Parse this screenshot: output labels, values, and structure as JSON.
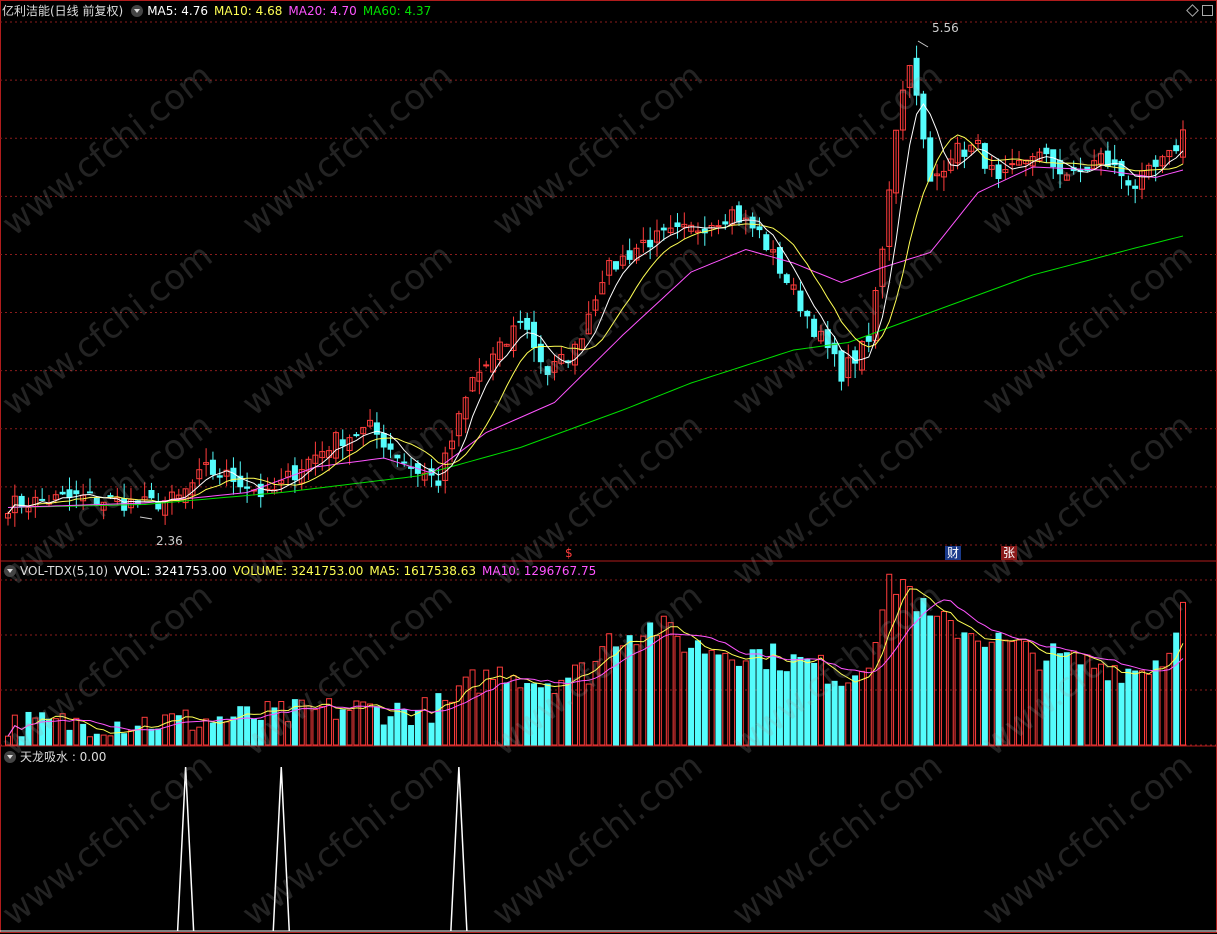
{
  "colors": {
    "up": "#ff3c3c",
    "down": "#54fcfc",
    "ma5": "#ffffff",
    "ma10": "#ffff54",
    "ma20": "#ff54ff",
    "ma60": "#00e000",
    "grid": "#8a1c1c",
    "border": "#b01c1c"
  },
  "price_panel": {
    "stock_name": "亿利洁能(日线 前复权)",
    "indicators": [
      {
        "label": "MA5: 4.76",
        "color": "#ffffff"
      },
      {
        "label": "MA10: 4.68",
        "color": "#ffff54"
      },
      {
        "label": "MA20: 4.70",
        "color": "#ff54ff"
      },
      {
        "label": "MA60: 4.37",
        "color": "#00e000"
      }
    ],
    "high_label": "5.56",
    "low_label": "2.36",
    "event_markers": [
      {
        "text": "$",
        "color": "#ff3c3c"
      },
      {
        "text": "财",
        "color": "#ffffff",
        "bg": "#1a3a8a"
      },
      {
        "text": "张",
        "color": "#ffffff",
        "bg": "#8a1a1a"
      }
    ]
  },
  "volume_panel": {
    "title": "VOL-TDX(5,10)",
    "indicators": [
      {
        "label": "VVOL: 3241753.00",
        "color": "#ffffff"
      },
      {
        "label": "VOLUME: 3241753.00",
        "color": "#ffff54"
      },
      {
        "label": "MA5: 1617538.63",
        "color": "#ffff54"
      },
      {
        "label": "MA10: 1296767.75",
        "color": "#ff54ff"
      }
    ]
  },
  "signal_panel": {
    "title": "天龙吸水 : 0.00"
  },
  "watermark_text": "www.cfchi.com",
  "chart_data": [
    {
      "type": "candlestick",
      "ylim": [
        2.2,
        5.7
      ],
      "high": 5.56,
      "low": 2.36,
      "close_anchors": [
        [
          0,
          2.47
        ],
        [
          10,
          2.52
        ],
        [
          20,
          2.47
        ],
        [
          25,
          2.51
        ],
        [
          29,
          2.7
        ],
        [
          34,
          2.63
        ],
        [
          38,
          2.52
        ],
        [
          43,
          2.73
        ],
        [
          48,
          2.9
        ],
        [
          53,
          2.98
        ],
        [
          59,
          2.72
        ],
        [
          63,
          2.63
        ],
        [
          68,
          3.3
        ],
        [
          73,
          3.55
        ],
        [
          75,
          3.72
        ],
        [
          79,
          3.35
        ],
        [
          83,
          3.5
        ],
        [
          87,
          4.0
        ],
        [
          93,
          4.22
        ],
        [
          100,
          4.3
        ],
        [
          106,
          4.42
        ],
        [
          110,
          4.28
        ],
        [
          118,
          3.65
        ],
        [
          122,
          3.35
        ],
        [
          126,
          3.55
        ],
        [
          128,
          4.2
        ],
        [
          130,
          5.0
        ],
        [
          132,
          5.45
        ],
        [
          135,
          4.6
        ],
        [
          138,
          4.82
        ],
        [
          142,
          4.85
        ],
        [
          145,
          4.6
        ],
        [
          150,
          4.82
        ],
        [
          156,
          4.65
        ],
        [
          160,
          4.78
        ],
        [
          165,
          4.6
        ],
        [
          170,
          4.78
        ],
        [
          172,
          4.95
        ]
      ],
      "ma60_anchors": [
        [
          0,
          2.45
        ],
        [
          20,
          2.47
        ],
        [
          40,
          2.55
        ],
        [
          60,
          2.66
        ],
        [
          75,
          2.85
        ],
        [
          90,
          3.1
        ],
        [
          100,
          3.28
        ],
        [
          115,
          3.5
        ],
        [
          123,
          3.55
        ],
        [
          135,
          3.75
        ],
        [
          150,
          4.0
        ],
        [
          165,
          4.18
        ],
        [
          172,
          4.26
        ]
      ],
      "ma20_anchors": [
        [
          0,
          2.45
        ],
        [
          20,
          2.48
        ],
        [
          35,
          2.55
        ],
        [
          45,
          2.72
        ],
        [
          55,
          2.78
        ],
        [
          62,
          2.68
        ],
        [
          70,
          2.95
        ],
        [
          80,
          3.15
        ],
        [
          90,
          3.6
        ],
        [
          100,
          4.02
        ],
        [
          108,
          4.17
        ],
        [
          115,
          4.08
        ],
        [
          122,
          3.95
        ],
        [
          128,
          4.05
        ],
        [
          135,
          4.15
        ],
        [
          142,
          4.55
        ],
        [
          150,
          4.72
        ],
        [
          160,
          4.7
        ],
        [
          168,
          4.65
        ],
        [
          172,
          4.7
        ]
      ]
    },
    {
      "type": "bar",
      "ylim": [
        0,
        3300000
      ],
      "last_volume": 3241753,
      "ma5_last": 1617538.63,
      "ma10_last": 1296767.75,
      "volume_profile": [
        [
          0,
          0.12
        ],
        [
          30,
          0.15
        ],
        [
          50,
          0.22
        ],
        [
          60,
          0.2
        ],
        [
          65,
          0.25
        ],
        [
          68,
          0.38
        ],
        [
          73,
          0.45
        ],
        [
          78,
          0.38
        ],
        [
          85,
          0.45
        ],
        [
          88,
          0.65
        ],
        [
          95,
          0.72
        ],
        [
          100,
          0.6
        ],
        [
          110,
          0.55
        ],
        [
          118,
          0.48
        ],
        [
          123,
          0.4
        ],
        [
          126,
          0.55
        ],
        [
          129,
          0.95
        ],
        [
          131,
          1.0
        ],
        [
          135,
          0.75
        ],
        [
          140,
          0.7
        ],
        [
          150,
          0.55
        ],
        [
          165,
          0.45
        ],
        [
          170,
          0.55
        ],
        [
          172,
          0.95
        ]
      ]
    },
    {
      "type": "line",
      "ylim": [
        0,
        1
      ],
      "value": 0.0,
      "spikes_at_index": [
        26,
        40,
        66
      ]
    }
  ]
}
